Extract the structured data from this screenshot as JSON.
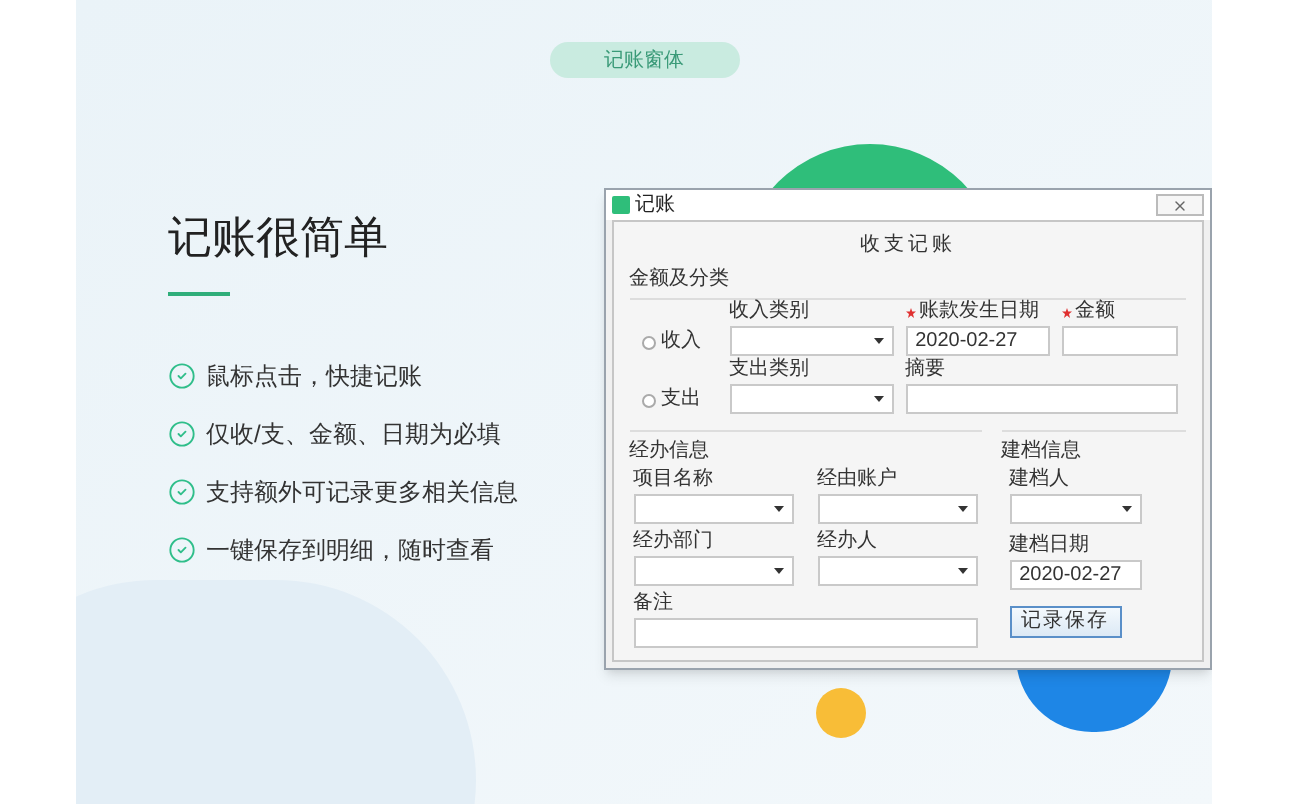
{
  "badge": "记账窗体",
  "headline": "记账很简单",
  "features": [
    "鼠标点击，快捷记账",
    "仅收/支、金额、日期为必填",
    "支持额外可记录更多相关信息",
    "一键保存到明细，随时查看"
  ],
  "dialog": {
    "title": "记账",
    "heading": "收支记账",
    "amount_section": {
      "title": "金额及分类",
      "rows": [
        {
          "radio": {
            "label": "收入",
            "selected": false
          },
          "fields": [
            {
              "kind": "select",
              "label": "收入类别",
              "required": false
            },
            {
              "kind": "text",
              "label": "账款发生日期",
              "required": true,
              "value": "2020-02-27"
            },
            {
              "kind": "text",
              "label": "金额",
              "required": true
            }
          ]
        },
        {
          "radio": {
            "label": "支出",
            "selected": false
          },
          "fields": [
            {
              "kind": "select",
              "label": "支出类别",
              "required": false
            },
            {
              "kind": "text",
              "label": "摘要",
              "required": false
            }
          ]
        }
      ]
    },
    "handling_section": {
      "title": "经办信息",
      "fields": [
        {
          "kind": "select",
          "label": "项目名称"
        },
        {
          "kind": "select",
          "label": "经由账户"
        },
        {
          "kind": "select",
          "label": "经办部门"
        },
        {
          "kind": "select",
          "label": "经办人"
        },
        {
          "kind": "text",
          "label": "备注"
        }
      ]
    },
    "archive_section": {
      "title": "建档信息",
      "fields": [
        {
          "kind": "select",
          "label": "建档人"
        },
        {
          "kind": "text",
          "label": "建档日期",
          "value": "2020-02-27"
        }
      ],
      "button": "记录保存"
    }
  }
}
